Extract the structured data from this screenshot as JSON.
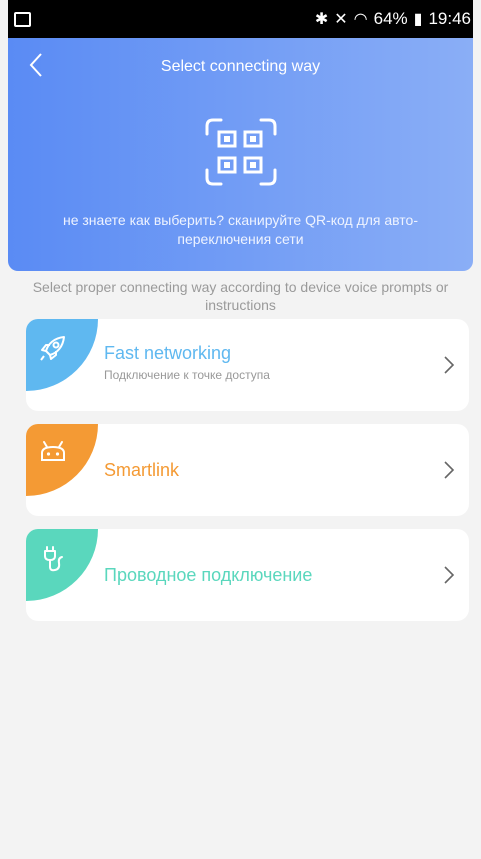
{
  "status_bar": {
    "battery": "64%",
    "time": "19:46"
  },
  "header": {
    "title": "Select connecting way",
    "qr_hint": "не знаете как выберить? сканируйте QR-код для авто-переключения сети"
  },
  "instructions": "Select proper connecting way according to device voice prompts or instructions",
  "options": [
    {
      "title": "Fast networking",
      "subtitle": "Подключение к точке доступа",
      "icon": "rocket-icon",
      "color": "#5fb8f0"
    },
    {
      "title": "Smartlink",
      "subtitle": "",
      "icon": "robot-icon",
      "color": "#f49a34"
    },
    {
      "title": "Проводное подключение",
      "subtitle": "",
      "icon": "plug-icon",
      "color": "#5ad7bd"
    }
  ]
}
